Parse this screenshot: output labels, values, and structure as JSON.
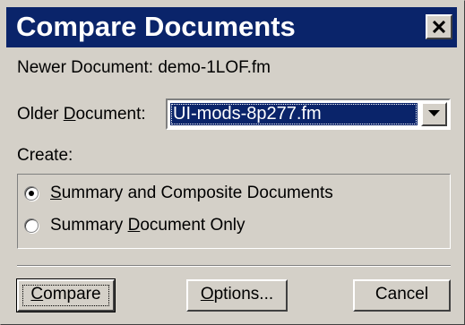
{
  "window": {
    "title": "Compare Documents",
    "close_icon": "close-icon"
  },
  "newer_document": {
    "label": "Newer Document: ",
    "value": "demo-1LOF.fm"
  },
  "older_document": {
    "label_pre": "Older ",
    "label_mnemonic": "D",
    "label_post": "ocument:",
    "selected_value": "UI-mods-8p277.fm",
    "dropdown_icon": "chevron-down-icon"
  },
  "create": {
    "label": "Create:",
    "options": [
      {
        "mnemonic": "S",
        "rest": "ummary and Composite Documents",
        "checked": true
      },
      {
        "pre": "Summary ",
        "mnemonic": "D",
        "rest": "ocument Only",
        "checked": false
      }
    ]
  },
  "buttons": {
    "compare": {
      "mnemonic": "C",
      "rest": "ompare"
    },
    "options": {
      "mnemonic": "O",
      "rest": "ptions..."
    },
    "cancel": {
      "label": "Cancel"
    }
  },
  "colors": {
    "titlebar": "#0a246a",
    "face": "#d4d0c8",
    "selection": "#0a246a"
  }
}
